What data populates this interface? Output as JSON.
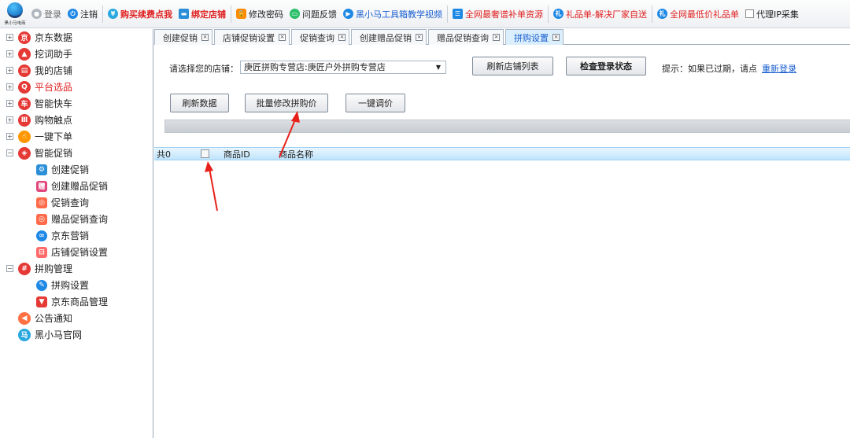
{
  "toolbar": {
    "logo_text": "黑小马电商",
    "items": [
      {
        "label": "登录"
      },
      {
        "label": "注销"
      },
      {
        "label": "购买续费点我"
      },
      {
        "label": "绑定店铺"
      },
      {
        "label": "修改密码"
      },
      {
        "label": "问题反馈"
      },
      {
        "label": "黑小马工具箱教学视频"
      },
      {
        "label": "全网最奢谱补单资源"
      },
      {
        "label": "礼品单-解决厂家自送"
      },
      {
        "label": "全网最低价礼品单"
      },
      {
        "label": "代理IP采集"
      }
    ]
  },
  "sidebar": {
    "items": [
      {
        "label": "京东数据",
        "expander": "+"
      },
      {
        "label": "挖词助手",
        "expander": "+"
      },
      {
        "label": "我的店铺",
        "expander": "+"
      },
      {
        "label": "平台选品",
        "expander": "+"
      },
      {
        "label": "智能快车",
        "expander": "+"
      },
      {
        "label": "购物触点",
        "expander": "+"
      },
      {
        "label": "一键下单",
        "expander": "+"
      },
      {
        "label": "智能促销",
        "expander": "−"
      },
      {
        "label": "创建促销"
      },
      {
        "label": "创建赠品促销"
      },
      {
        "label": "促销查询"
      },
      {
        "label": "赠品促销查询"
      },
      {
        "label": "京东营销"
      },
      {
        "label": "店铺促销设置"
      },
      {
        "label": "拼购管理",
        "expander": "−"
      },
      {
        "label": "拼购设置"
      },
      {
        "label": "京东商品管理"
      },
      {
        "label": "公告通知"
      },
      {
        "label": "黑小马官网"
      }
    ]
  },
  "tabs": [
    {
      "label": "创建促销"
    },
    {
      "label": "店铺促销设置"
    },
    {
      "label": "促销查询"
    },
    {
      "label": "创建赠品促销"
    },
    {
      "label": "赠品促销查询"
    },
    {
      "label": "拼购设置"
    }
  ],
  "tab_close_glyph": "×",
  "form": {
    "store_label": "请选择您的店铺：",
    "store_value": "庚匠拼购专营店:庚匠户外拼购专营店",
    "refresh_store_button": "刷新店铺列表",
    "check_login_button": "检查登录状态",
    "hint_text": "提示：如果已过期，请点",
    "relogin_link": "重新登录",
    "refresh_data_button": "刷新数据",
    "batch_modify_button": "批量修改拼购价",
    "one_click_button": "一键调价"
  },
  "grid": {
    "count_label": "共0",
    "col_id": "商品ID",
    "col_name": "商品名称"
  },
  "colors": {
    "accent": "#1a5fd0",
    "arrow": "#e8201a",
    "header_blue": "#bfe4fb"
  }
}
